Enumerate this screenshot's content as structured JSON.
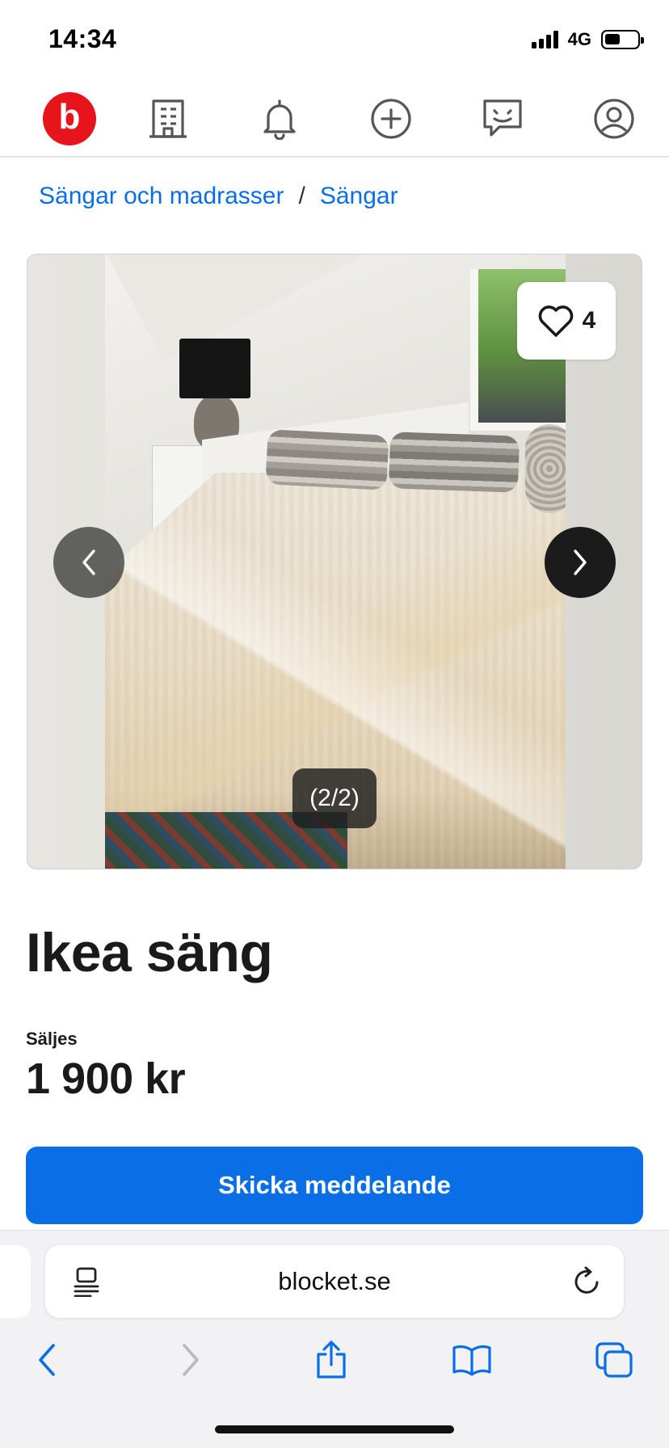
{
  "status_bar": {
    "time": "14:34",
    "network": "4G"
  },
  "app_nav": {
    "logo_letter": "b",
    "items": [
      "home-logo",
      "business-icon",
      "bell-icon",
      "add-icon",
      "messages-icon",
      "profile-icon"
    ]
  },
  "breadcrumb": {
    "category": "Sängar och madrasser",
    "separator": "/",
    "subcategory": "Sängar"
  },
  "gallery": {
    "favorites_count": "4",
    "counter": "(2/2)"
  },
  "listing": {
    "title": "Ikea säng",
    "type_label": "Säljes",
    "price": "1 900 kr",
    "cta_label": "Skicka meddelande"
  },
  "browser": {
    "url": "blocket.se"
  },
  "colors": {
    "brand_red": "#e8141b",
    "accent_blue": "#0a6ee6"
  }
}
